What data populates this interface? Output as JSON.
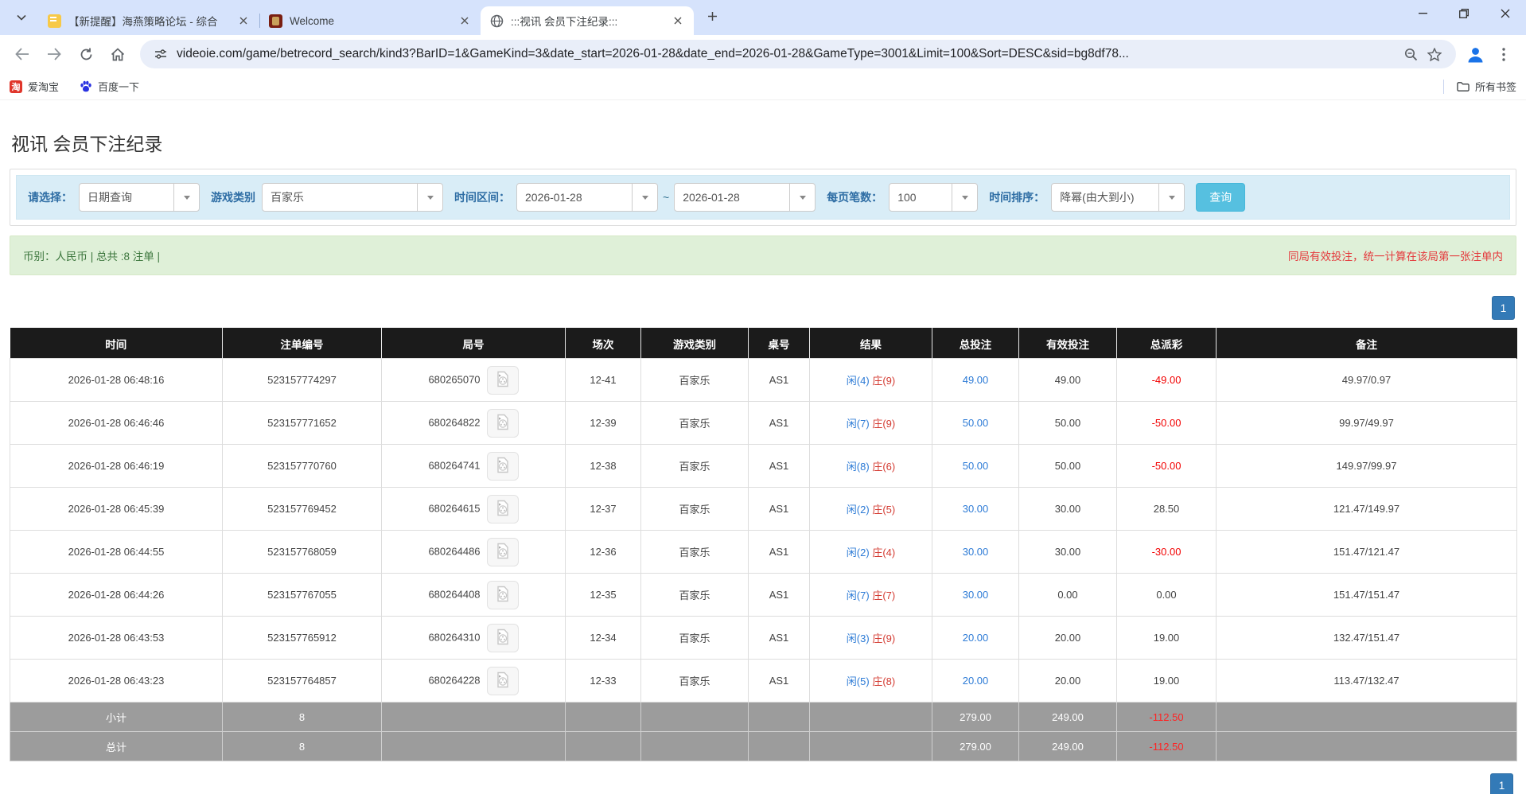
{
  "browser": {
    "tabs": [
      {
        "title": "【新提醒】海燕策略论坛 - 综合",
        "active": false
      },
      {
        "title": "Welcome",
        "active": false
      },
      {
        "title": ":::视讯 会员下注纪录:::",
        "active": true
      }
    ],
    "url": "videoie.com/game/betrecord_search/kind3?BarID=1&GameKind=3&date_start=2026-01-28&date_end=2026-01-28&GameType=3001&Limit=100&Sort=DESC&sid=bg8df78...",
    "bookmarks": {
      "item1": "爱淘宝",
      "item2": "百度一下",
      "all_label": "所有书签",
      "taobao_glyph": "淘"
    }
  },
  "page": {
    "title": "视讯 会员下注纪录",
    "filters": {
      "select_label": "请选择：",
      "select_value": "日期查询",
      "game_type_label": "游戏类别",
      "game_type_value": "百家乐",
      "date_range_label": "时间区间：",
      "date_start": "2026-01-28",
      "date_separator": "~",
      "date_end": "2026-01-28",
      "per_page_label": "每页笔数：",
      "per_page_value": "100",
      "sort_label": "时间排序：",
      "sort_value": "降幂(由大到小)",
      "search_button": "查询"
    },
    "summary": {
      "left": "币别：人民币 | 总共 :8 注单 |",
      "right": "同局有效投注，统一计算在该局第一张注单内"
    },
    "pagination": "1",
    "table": {
      "headers": [
        "时间",
        "注单编号",
        "局号",
        "场次",
        "游戏类别",
        "桌号",
        "结果",
        "总投注",
        "有效投注",
        "总派彩",
        "备注"
      ],
      "rows": [
        {
          "time": "2026-01-28 06:48:16",
          "bet_id": "523157774297",
          "round": "680265070",
          "session": "12-41",
          "game": "百家乐",
          "table_no": "AS1",
          "result_player": "闲(4)",
          "result_banker": "庄(9)",
          "total_bet": "49.00",
          "valid_bet": "49.00",
          "payout": "-49.00",
          "remark": "49.97/0.97"
        },
        {
          "time": "2026-01-28 06:46:46",
          "bet_id": "523157771652",
          "round": "680264822",
          "session": "12-39",
          "game": "百家乐",
          "table_no": "AS1",
          "result_player": "闲(7)",
          "result_banker": "庄(9)",
          "total_bet": "50.00",
          "valid_bet": "50.00",
          "payout": "-50.00",
          "remark": "99.97/49.97"
        },
        {
          "time": "2026-01-28 06:46:19",
          "bet_id": "523157770760",
          "round": "680264741",
          "session": "12-38",
          "game": "百家乐",
          "table_no": "AS1",
          "result_player": "闲(8)",
          "result_banker": "庄(6)",
          "total_bet": "50.00",
          "valid_bet": "50.00",
          "payout": "-50.00",
          "remark": "149.97/99.97"
        },
        {
          "time": "2026-01-28 06:45:39",
          "bet_id": "523157769452",
          "round": "680264615",
          "session": "12-37",
          "game": "百家乐",
          "table_no": "AS1",
          "result_player": "闲(2)",
          "result_banker": "庄(5)",
          "total_bet": "30.00",
          "valid_bet": "30.00",
          "payout": "28.50",
          "remark": "121.47/149.97"
        },
        {
          "time": "2026-01-28 06:44:55",
          "bet_id": "523157768059",
          "round": "680264486",
          "session": "12-36",
          "game": "百家乐",
          "table_no": "AS1",
          "result_player": "闲(2)",
          "result_banker": "庄(4)",
          "total_bet": "30.00",
          "valid_bet": "30.00",
          "payout": "-30.00",
          "remark": "151.47/121.47"
        },
        {
          "time": "2026-01-28 06:44:26",
          "bet_id": "523157767055",
          "round": "680264408",
          "session": "12-35",
          "game": "百家乐",
          "table_no": "AS1",
          "result_player": "闲(7)",
          "result_banker": "庄(7)",
          "total_bet": "30.00",
          "valid_bet": "0.00",
          "payout": "0.00",
          "remark": "151.47/151.47"
        },
        {
          "time": "2026-01-28 06:43:53",
          "bet_id": "523157765912",
          "round": "680264310",
          "session": "12-34",
          "game": "百家乐",
          "table_no": "AS1",
          "result_player": "闲(3)",
          "result_banker": "庄(9)",
          "total_bet": "20.00",
          "valid_bet": "20.00",
          "payout": "19.00",
          "remark": "132.47/151.47"
        },
        {
          "time": "2026-01-28 06:43:23",
          "bet_id": "523157764857",
          "round": "680264228",
          "session": "12-33",
          "game": "百家乐",
          "table_no": "AS1",
          "result_player": "闲(5)",
          "result_banker": "庄(8)",
          "total_bet": "20.00",
          "valid_bet": "20.00",
          "payout": "19.00",
          "remark": "113.47/132.47"
        }
      ],
      "footer": [
        {
          "label": "小计",
          "count": "8",
          "total_bet": "279.00",
          "valid_bet": "249.00",
          "payout": "-112.50"
        },
        {
          "label": "总计",
          "count": "8",
          "total_bet": "279.00",
          "valid_bet": "249.00",
          "payout": "-112.50"
        }
      ]
    }
  }
}
